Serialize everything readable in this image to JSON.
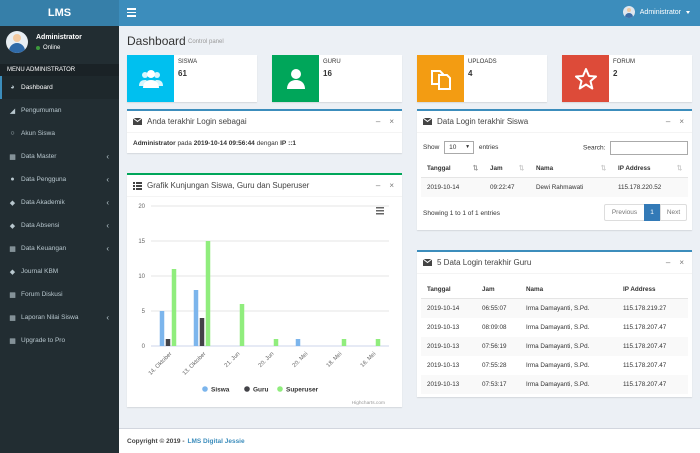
{
  "app": {
    "logo": "LMS"
  },
  "topbar": {
    "user_label": "Administrator"
  },
  "sidebar": {
    "user_name": "Administrator",
    "user_status": "Online",
    "menu_header": "MENU ADMINISTRATOR",
    "items": [
      {
        "label": "Dashboard",
        "icon": "dashboard-icon",
        "glyph": "◕",
        "chevron": false
      },
      {
        "label": "Pengumuman",
        "icon": "bullhorn-icon",
        "glyph": "◢",
        "chevron": false
      },
      {
        "label": "Akun Siswa",
        "icon": "circle-icon",
        "glyph": "○",
        "chevron": false
      },
      {
        "label": "Data Master",
        "icon": "th-icon",
        "glyph": "▦",
        "chevron": true
      },
      {
        "label": "Data Pengguna",
        "icon": "user-icon",
        "glyph": "●",
        "chevron": true
      },
      {
        "label": "Data Akademik",
        "icon": "tag-icon",
        "glyph": "◆",
        "chevron": true
      },
      {
        "label": "Data Absensi",
        "icon": "tag-icon",
        "glyph": "◆",
        "chevron": true
      },
      {
        "label": "Data Keuangan",
        "icon": "th-icon",
        "glyph": "▦",
        "chevron": true
      },
      {
        "label": "Journal KBM",
        "icon": "tag-icon",
        "glyph": "◆",
        "chevron": false
      },
      {
        "label": "Forum Diskusi",
        "icon": "th-icon",
        "glyph": "▦",
        "chevron": false
      },
      {
        "label": "Laporan Nilai Siswa",
        "icon": "th-icon",
        "glyph": "▦",
        "chevron": true
      },
      {
        "label": "Upgrade to Pro",
        "icon": "th-icon",
        "glyph": "▦",
        "chevron": false
      }
    ]
  },
  "header": {
    "title": "Dashboard",
    "subtitle": "Control panel"
  },
  "info_boxes": [
    {
      "label": "SISWA",
      "value": "61",
      "color": "#00c0ef",
      "icon": "users-icon"
    },
    {
      "label": "GURU",
      "value": "16",
      "color": "#00a65a",
      "icon": "user-icon"
    },
    {
      "label": "UPLOADS",
      "value": "4",
      "color": "#f39c12",
      "icon": "files-icon"
    },
    {
      "label": "FORUM",
      "value": "2",
      "color": "#dd4b39",
      "icon": "star-icon"
    }
  ],
  "login_as": {
    "title": "Anda terakhir Login sebagai",
    "user": "Administrator",
    "text_pada": "pada",
    "datetime": "2019-10-14 09:56:44",
    "text_dengan": "dengan",
    "ip_label": "IP",
    "ip": "::1"
  },
  "siswa_login": {
    "title": "Data Login terakhir Siswa",
    "show_label": "Show",
    "show_value": "10",
    "entries_label": "entries",
    "search_label": "Search:",
    "columns": [
      "Tanggal",
      "Jam",
      "Nama",
      "IP Address"
    ],
    "rows": [
      [
        "2019-10-14",
        "09:22:47",
        "Dewi Rahmawati",
        "115.178.220.52"
      ]
    ],
    "info": "Showing 1 to 1 of 1 entries",
    "prev": "Previous",
    "page": "1",
    "next": "Next"
  },
  "guru_login": {
    "title": "5 Data Login terakhir Guru",
    "columns": [
      "Tanggal",
      "Jam",
      "Nama",
      "IP Address"
    ],
    "rows": [
      [
        "2019-10-14",
        "06:55:07",
        "Irma Damayanti, S.Pd.",
        "115.178.219.27"
      ],
      [
        "2019-10-13",
        "08:09:08",
        "Irma Damayanti, S.Pd.",
        "115.178.207.47"
      ],
      [
        "2019-10-13",
        "07:56:19",
        "Irma Damayanti, S.Pd.",
        "115.178.207.47"
      ],
      [
        "2019-10-13",
        "07:55:28",
        "Irma Damayanti, S.Pd.",
        "115.178.207.47"
      ],
      [
        "2019-10-13",
        "07:53:17",
        "Irma Damayanti, S.Pd.",
        "115.178.207.47"
      ]
    ]
  },
  "chart_box": {
    "title": "Grafik Kunjungan Siswa, Guru dan Superuser",
    "credit": "Highcharts.com"
  },
  "chart_data": {
    "type": "bar",
    "categories": [
      "14. Oktober",
      "13. Oktober",
      "21. Jun",
      "20. Jun",
      "20. Mei",
      "18. Mei",
      "16. Mei"
    ],
    "series": [
      {
        "name": "Siswa",
        "values": [
          5,
          8,
          0,
          0,
          1,
          0,
          0
        ],
        "color": "#7cb5ec"
      },
      {
        "name": "Guru",
        "values": [
          1,
          4,
          0,
          0,
          0,
          0,
          0
        ],
        "color": "#434348"
      },
      {
        "name": "Superuser",
        "values": [
          11,
          15,
          6,
          1,
          0,
          1,
          1
        ],
        "color": "#90ed7d"
      }
    ],
    "yticks": [
      "0",
      "5",
      "10",
      "15",
      "20"
    ],
    "ylim": [
      0,
      20
    ],
    "legend": "bottom",
    "grid": true
  },
  "footer": {
    "copyright": "Copyright © 2019 -",
    "brand": "LMS Digital Jessie"
  }
}
